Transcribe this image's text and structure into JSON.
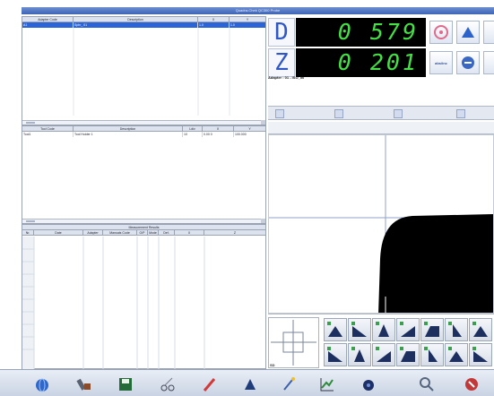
{
  "window": {
    "title": "Quadra-Chek QC300 Probe"
  },
  "adapter_table": {
    "columns": [
      "Adapter Code",
      "Description",
      "X",
      "Y"
    ],
    "rows": [
      {
        "code": "A1",
        "description": "Sphr_ 01",
        "x": "1.0",
        "y": "1.0"
      }
    ]
  },
  "tool_table": {
    "columns": [
      "Tool Code",
      "Description",
      "Ldiv",
      "X",
      "Y"
    ],
    "rows": [
      {
        "code": "Tool1",
        "description": "Tool Holder 1",
        "ldiv": "10",
        "x": "0.00 0",
        "y": "100.000"
      }
    ]
  },
  "measurement_results": {
    "caption": "Measurement Results",
    "columns": [
      "Nr.",
      "Date",
      "Adapter",
      "Manuals Code",
      "O/P",
      "Mode",
      "Def.",
      "X",
      "Z"
    ]
  },
  "dro": {
    "axis_d": "D",
    "value_d": "0 579",
    "axis_z": "Z",
    "value_z": "0 201",
    "adapter_info": "Adapter : 01 - ISO_50",
    "mode_label": "abs/inc"
  },
  "mini_view": {
    "label": "SD"
  },
  "colors": {
    "readout_bg": "#000000",
    "readout_digits": "#45e045",
    "axis_letter": "#2f56c5",
    "selection": "#2a64d6"
  },
  "toolbar": {
    "icons": [
      "globe-icon",
      "wrench-tools-icon",
      "save-disk-icon",
      "scissors-icon",
      "pen-edit-icon",
      "probe-holder-icon",
      "wand-icon",
      "graph-icon",
      "camera-icon",
      "search-icon",
      "exit-icon"
    ]
  }
}
